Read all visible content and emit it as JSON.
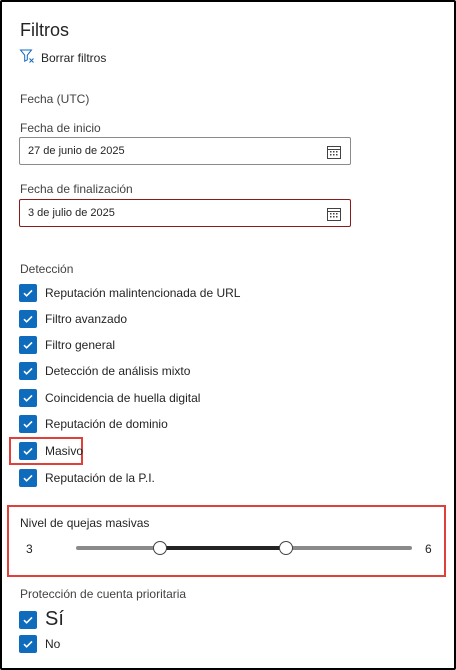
{
  "panel": {
    "title": "Filtros",
    "clear_filters": "Borrar filtros"
  },
  "date": {
    "section": "Fecha (UTC)",
    "start_label": "Fecha de inicio",
    "start_value": "27 de junio de 2025",
    "end_label": "Fecha de finalización",
    "end_value": "3 de julio de 2025"
  },
  "detection": {
    "section": "Detección",
    "items": [
      {
        "label": "Reputación malintencionada de URL",
        "checked": true
      },
      {
        "label": "Filtro avanzado",
        "checked": true
      },
      {
        "label": "Filtro general",
        "checked": true
      },
      {
        "label": "Detección de análisis mixto",
        "checked": true
      },
      {
        "label": "Coincidencia de huella digital",
        "checked": true
      },
      {
        "label": "Reputación de dominio",
        "checked": true
      },
      {
        "label": "Masivo",
        "checked": true
      },
      {
        "label": "Reputación de la P.I.",
        "checked": true
      }
    ]
  },
  "bulk": {
    "label": "Nivel de quejas masivas",
    "min_value": "3",
    "max_value": "6",
    "range_low": 3,
    "range_high": 6
  },
  "priority": {
    "section": "Protección de cuenta prioritaria",
    "items": [
      {
        "label": "Sí",
        "checked": true
      },
      {
        "label": "No",
        "checked": true
      }
    ]
  },
  "colors": {
    "accent": "#0f6cbd",
    "highlight": "#e0403a",
    "active_field_border": "#8b1a1a"
  }
}
